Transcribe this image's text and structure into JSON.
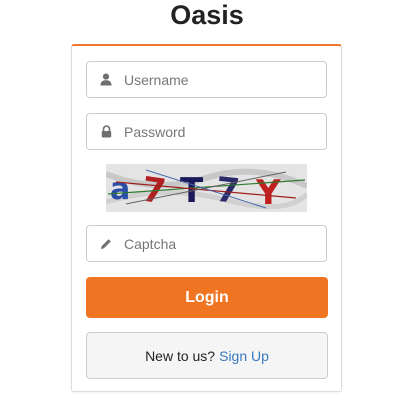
{
  "header": {
    "title": "Oasis"
  },
  "form": {
    "username": {
      "placeholder": "Username",
      "value": "",
      "icon": "user-icon"
    },
    "password": {
      "placeholder": "Password",
      "value": "",
      "icon": "lock-icon"
    },
    "captcha_image": {
      "text": "a7T7Y"
    },
    "captcha": {
      "placeholder": "Captcha",
      "value": "",
      "icon": "pencil-icon"
    },
    "login_label": "Login"
  },
  "signup": {
    "prompt": "New to us?",
    "link_label": "Sign Up"
  },
  "colors": {
    "accent": "#f07523",
    "link": "#3a7bbf",
    "card_border": "#dddddd"
  }
}
